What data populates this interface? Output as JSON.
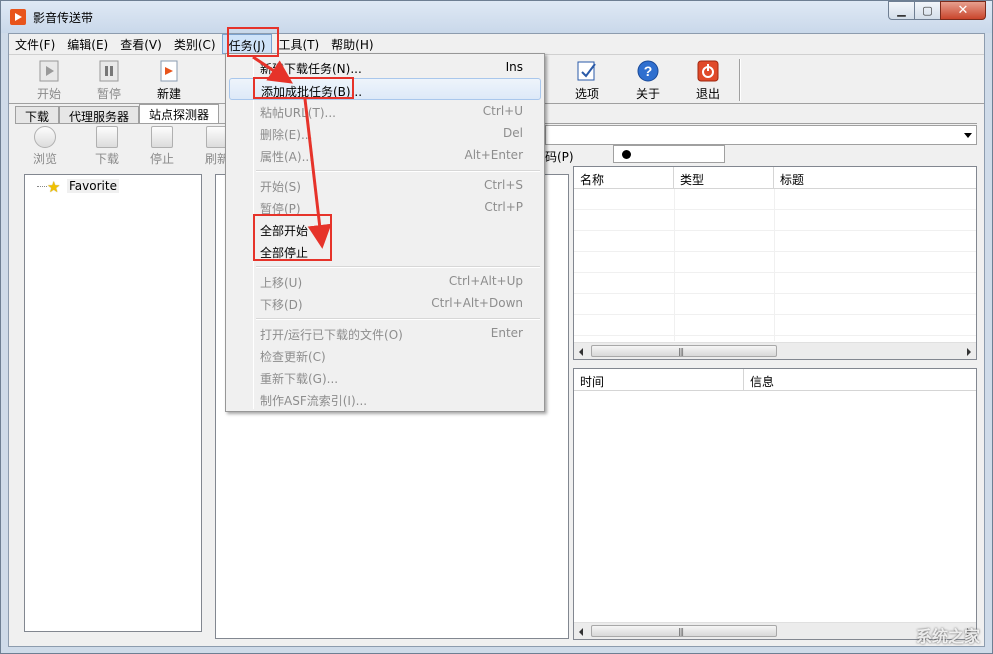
{
  "window": {
    "title": "影音传送带"
  },
  "menubar": [
    "文件(F)",
    "编辑(E)",
    "查看(V)",
    "类别(C)",
    "任务(J)",
    "工具(T)",
    "帮助(H)"
  ],
  "toolbar": {
    "start": "开始",
    "pause": "暂停",
    "new": "新建",
    "options": "选项",
    "about": "关于",
    "exit": "退出"
  },
  "tabs": [
    "下载",
    "代理服务器",
    "站点探测器"
  ],
  "subtoolbar": [
    "浏览",
    "下载",
    "停止",
    "刷新"
  ],
  "password_label": "码(P)",
  "tree": {
    "root": "Favorite"
  },
  "list_columns": [
    "名称",
    "类型",
    "标题"
  ],
  "log_columns": [
    "时间",
    "信息"
  ],
  "task_menu": [
    {
      "label": "新建下载任务(N)...",
      "shortcut": "Ins"
    },
    {
      "label": "添加成批任务(B)...",
      "shortcut": ""
    },
    {
      "label": "粘帖URL(T)...",
      "shortcut": "Ctrl+U"
    },
    {
      "label": "删除(E)...",
      "shortcut": "Del"
    },
    {
      "label": "属性(A)...",
      "shortcut": "Alt+Enter"
    },
    {
      "label": "开始(S)",
      "shortcut": "Ctrl+S"
    },
    {
      "label": "暂停(P)",
      "shortcut": "Ctrl+P"
    },
    {
      "label": "全部开始",
      "shortcut": ""
    },
    {
      "label": "全部停止",
      "shortcut": ""
    },
    {
      "label": "上移(U)",
      "shortcut": "Ctrl+Alt+Up"
    },
    {
      "label": "下移(D)",
      "shortcut": "Ctrl+Alt+Down"
    },
    {
      "label": "打开/运行已下载的文件(O)",
      "shortcut": "Enter"
    },
    {
      "label": "检查更新(C)",
      "shortcut": ""
    },
    {
      "label": "重新下载(G)...",
      "shortcut": ""
    },
    {
      "label": "制作ASF流索引(I)...",
      "shortcut": ""
    }
  ],
  "colors": {
    "annotation": "#e6332a",
    "menu_highlight": "#cfe3f9"
  }
}
